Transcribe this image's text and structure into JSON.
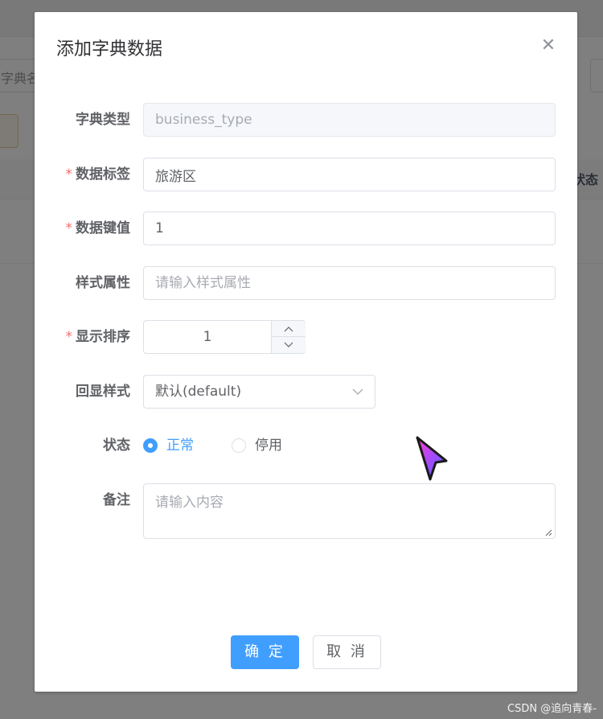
{
  "background": {
    "search_text": "字典名",
    "table_status_header": "状态"
  },
  "dialog": {
    "title": "添加字典数据",
    "close_icon": "close-icon",
    "fields": {
      "dict_type": {
        "label": "字典类型",
        "value": "business_type",
        "required": false,
        "disabled": true
      },
      "dict_label": {
        "label": "数据标签",
        "value": "旅游区",
        "required": true
      },
      "dict_value": {
        "label": "数据键值",
        "value": "1",
        "required": true
      },
      "css_class": {
        "label": "样式属性",
        "placeholder": "请输入样式属性",
        "required": false
      },
      "dict_sort": {
        "label": "显示排序",
        "value": "1",
        "required": true
      },
      "list_class": {
        "label": "回显样式",
        "value": "默认(default)",
        "required": false
      },
      "status": {
        "label": "状态",
        "options": [
          {
            "label": "正常",
            "checked": true
          },
          {
            "label": "停用",
            "checked": false
          }
        ]
      },
      "remark": {
        "label": "备注",
        "placeholder": "请输入内容"
      }
    },
    "required_mark": "*",
    "confirm_label": "确 定",
    "cancel_label": "取 消"
  },
  "watermark": "CSDN @追向青春-",
  "colors": {
    "primary": "#409eff",
    "required": "#f56c6c",
    "overlay": "rgba(0,0,0,0.5)"
  }
}
